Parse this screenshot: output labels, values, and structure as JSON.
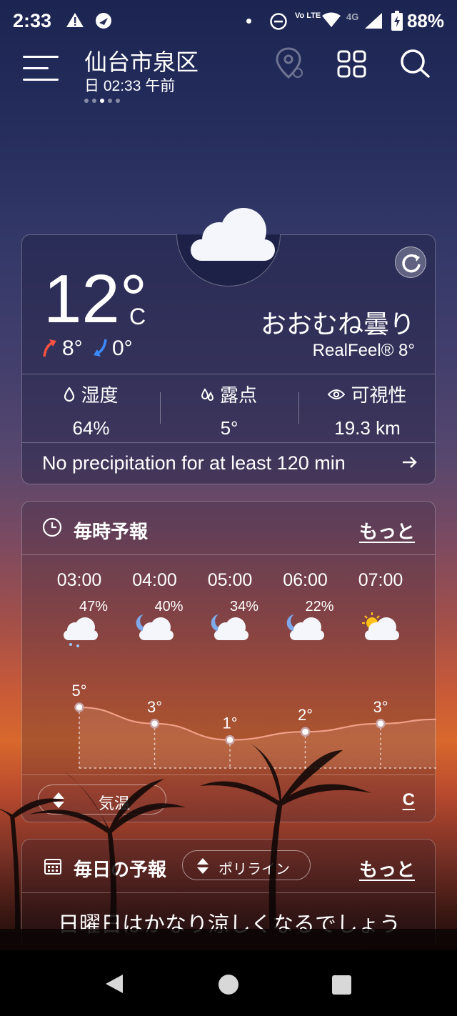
{
  "status_bar": {
    "time": "2:33",
    "battery": "88%",
    "network": "4G",
    "volte": "Vo LTE"
  },
  "header": {
    "location": "仙台市泉区",
    "datetime": "日 02:33 午前"
  },
  "current": {
    "temp": "12°",
    "unit": "C",
    "high": "8°",
    "low": "0°",
    "condition": "おおむね曇り",
    "realfeel": "RealFeel® 8°",
    "stats": [
      {
        "label": "湿度",
        "value": "64%",
        "icon": "droplet-icon"
      },
      {
        "label": "露点",
        "value": "5°",
        "icon": "dewpoint-icon"
      },
      {
        "label": "可視性",
        "value": "19.3 km",
        "icon": "eye-icon"
      }
    ],
    "precip_message": "No precipitation for at least 120 min"
  },
  "hourly": {
    "title": "毎時予報",
    "more": "もっと",
    "hours": [
      {
        "time": "03:00",
        "precip": "47%",
        "icon": "cloud-rain-icon",
        "temp": "5°"
      },
      {
        "time": "04:00",
        "precip": "40%",
        "icon": "cloud-moon-icon",
        "temp": "3°"
      },
      {
        "time": "05:00",
        "precip": "34%",
        "icon": "cloud-moon-icon",
        "temp": "1°"
      },
      {
        "time": "06:00",
        "precip": "22%",
        "icon": "cloud-moon-icon",
        "temp": "2°"
      },
      {
        "time": "07:00",
        "precip": "",
        "icon": "cloud-sun-icon",
        "temp": "3°"
      }
    ],
    "chart_data": {
      "type": "line",
      "categories": [
        "03:00",
        "04:00",
        "05:00",
        "06:00",
        "07:00"
      ],
      "series": [
        {
          "values": [
            5,
            3,
            1,
            2,
            3
          ]
        }
      ]
    },
    "selector": "気温",
    "unit_toggle": "C"
  },
  "daily": {
    "title": "毎日の予報",
    "mode": "ポリライン",
    "more": "もっと",
    "message": "日曜日はかなり涼しくなるでしょう"
  }
}
